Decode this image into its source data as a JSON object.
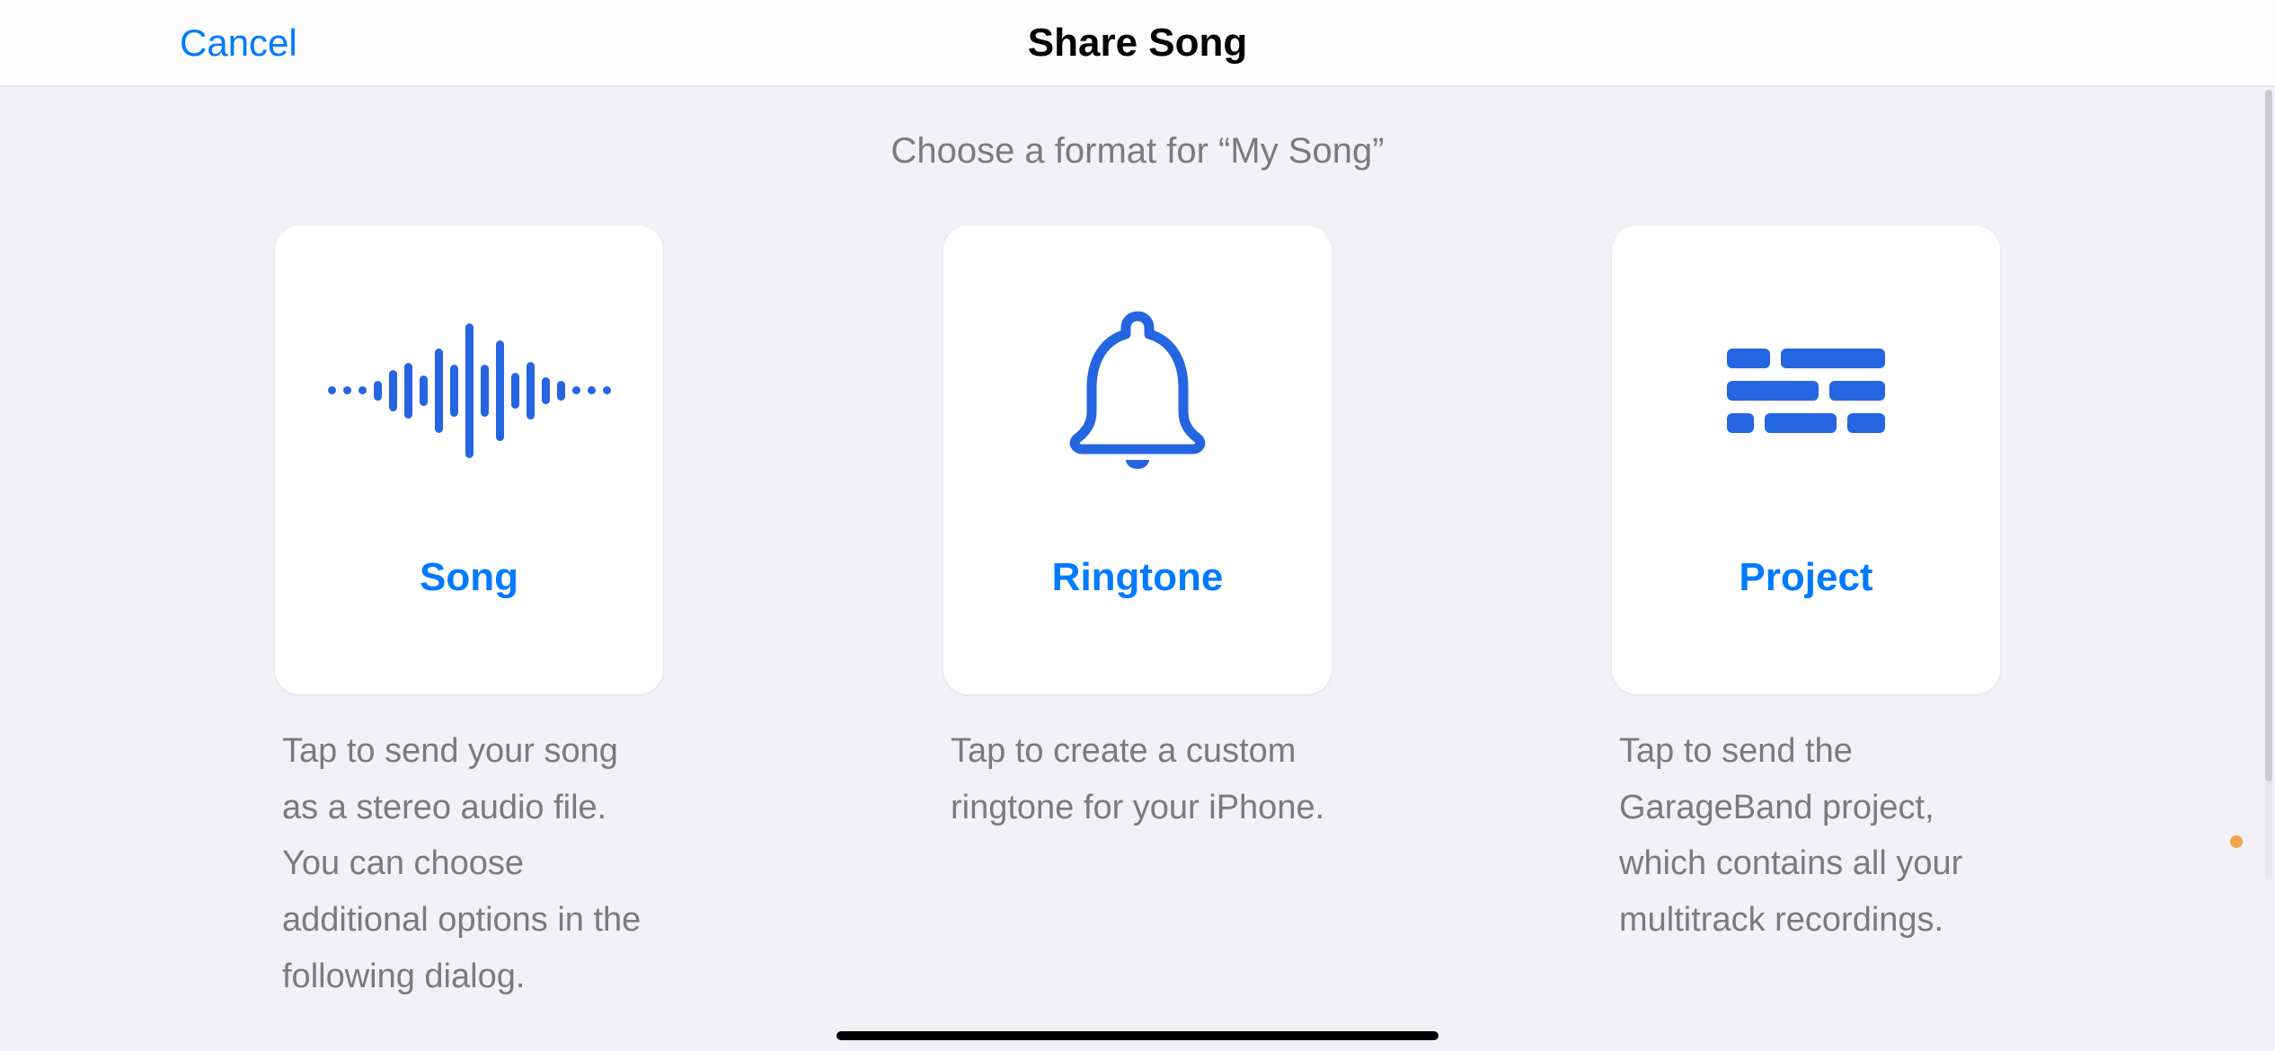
{
  "navbar": {
    "cancel_label": "Cancel",
    "title": "Share Song"
  },
  "main": {
    "prompt": "Choose a format for “My Song”",
    "cards": {
      "song": {
        "title": "Song",
        "description": "Tap to send your song as a stereo audio file. You can choose additional options in the following dialog.",
        "icon": "waveform-icon"
      },
      "ringtone": {
        "title": "Ringtone",
        "description": "Tap to create a custom ringtone for your iPhone.",
        "icon": "bell-icon"
      },
      "project": {
        "title": "Project",
        "description": "Tap to send the GarageBand project, which contains all your multitrack recordings.",
        "icon": "multitrack-icon"
      }
    }
  },
  "colors": {
    "accent": "#007aff",
    "icon": "#2665e1",
    "muted_text": "#7a7a7f",
    "background": "#f2f2f6"
  }
}
